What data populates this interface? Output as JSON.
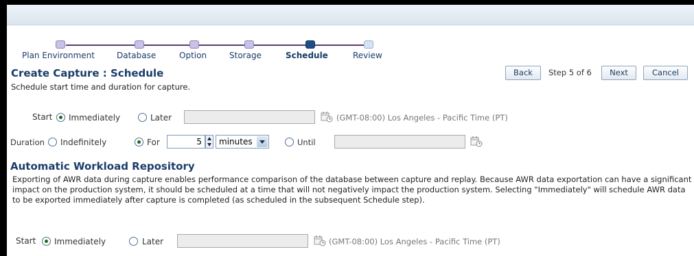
{
  "train": {
    "steps": [
      {
        "label": "Plan Environment",
        "state": "visited"
      },
      {
        "label": "Database",
        "state": "visited"
      },
      {
        "label": "Option",
        "state": "visited"
      },
      {
        "label": "Storage",
        "state": "visited"
      },
      {
        "label": "Schedule",
        "state": "current"
      },
      {
        "label": "Review",
        "state": "future"
      }
    ]
  },
  "page": {
    "title": "Create Capture : Schedule",
    "description": "Schedule start time and duration for capture."
  },
  "nav": {
    "back_label": "Back",
    "step_text": "Step 5 of 6",
    "next_label": "Next",
    "cancel_label": "Cancel"
  },
  "capture": {
    "start_label": "Start",
    "immediately_label": "Immediately",
    "later_label": "Later",
    "start_selected": "Immediately",
    "later_value": "",
    "timezone": "(GMT-08:00) Los Angeles - Pacific Time (PT)",
    "duration_label": "Duration",
    "indefinitely_label": "Indefinitely",
    "for_label": "For",
    "duration_selected": "For",
    "for_value": "5",
    "unit_selected": "minutes",
    "until_label": "Until",
    "until_value": ""
  },
  "awr": {
    "title": "Automatic Workload Repository",
    "description": "Exporting of AWR data during capture enables performance comparison of the database between capture and replay. Because AWR data exportation can have a significant impact on the production system, it should be scheduled at a time that will not negatively impact the production system. Selecting \"Immediately\" will schedule AWR data to be exported immediately after capture is completed (as scheduled in the subsequent Schedule step).",
    "start_label": "Start",
    "immediately_label": "Immediately",
    "later_label": "Later",
    "start_selected": "Immediately",
    "later_value": "",
    "timezone": "(GMT-08:00) Los Angeles - Pacific Time (PT)"
  },
  "icons": {
    "calendar": "calendar-icon"
  }
}
